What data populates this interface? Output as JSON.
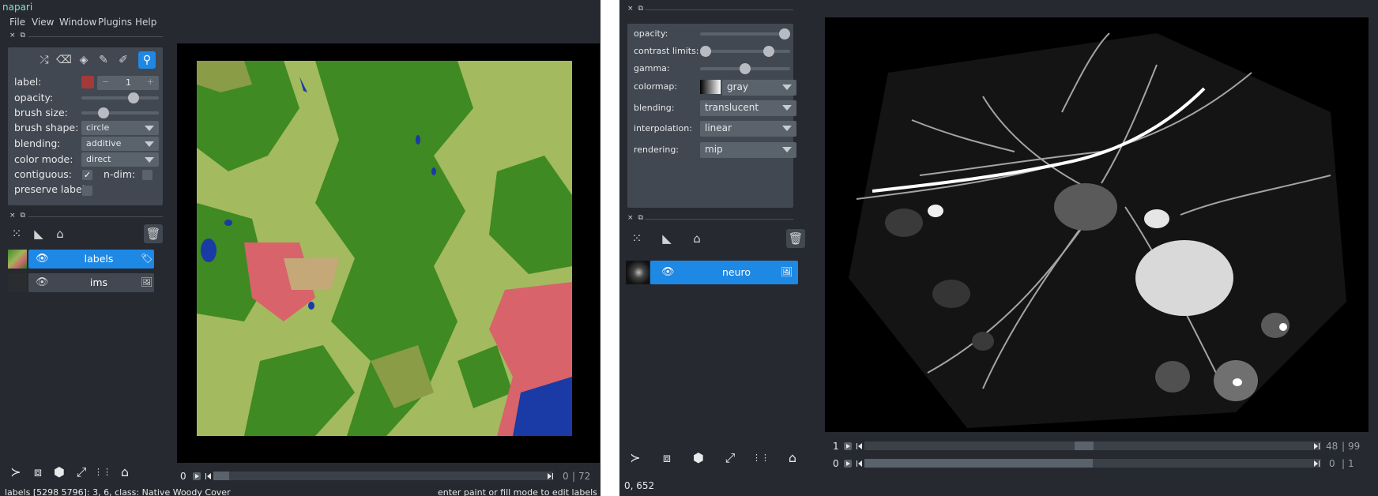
{
  "left": {
    "app_title": "napari",
    "menu": [
      "File",
      "View",
      "Window",
      "Plugins",
      "Help"
    ],
    "dock_controls": [
      "×",
      "⧉"
    ],
    "tools": [
      {
        "name": "shuffle-icon",
        "glyph": "⤮",
        "active": false
      },
      {
        "name": "eraser-icon",
        "glyph": "⌫",
        "active": false
      },
      {
        "name": "fill-icon",
        "glyph": "◈",
        "active": false
      },
      {
        "name": "paint-brush-icon",
        "glyph": "✎",
        "active": false
      },
      {
        "name": "color-picker-icon",
        "glyph": "✐",
        "active": false
      },
      {
        "name": "zoom-icon",
        "glyph": "⚲",
        "active": true
      }
    ],
    "label_label": "label:",
    "label_value": "1",
    "label_minus": "−",
    "label_plus": "+",
    "label_color": "#a33a3a",
    "opacity_label": "opacity:",
    "opacity_value": 0.7,
    "brush_size_label": "brush size:",
    "brush_size_value": 0.25,
    "brush_shape_label": "brush shape:",
    "brush_shape_value": "circle",
    "blending_label": "blending:",
    "blending_value": "additive",
    "color_mode_label": "color mode:",
    "color_mode_value": "direct",
    "contiguous_label": "contiguous:",
    "contiguous_checked": "✓",
    "ndim_label": "n-dim:",
    "preserve_label": "preserve label",
    "layers": [
      {
        "name": "labels",
        "selected": true,
        "type_icon": "label-icon",
        "glyph": "🏷"
      },
      {
        "name": "ims",
        "selected": false,
        "type_icon": "image-icon",
        "glyph": "🖼"
      }
    ],
    "eye_glyph": "👁",
    "dims": {
      "current": "0",
      "current_label": "0",
      "sep": "|",
      "max": "72",
      "fraction": 0.0
    },
    "status_left": "labels [5298 5796]: 3, 6, class: Native Woody Cover",
    "status_right": "enter paint or fill mode to edit labels"
  },
  "right": {
    "dock_controls": [
      "×",
      "⧉"
    ],
    "opacity_label": "opacity:",
    "opacity_value": 1.0,
    "contrast_label": "contrast limits:",
    "contrast_low": 0.0,
    "contrast_high": 0.8,
    "gamma_label": "gamma:",
    "gamma_value": 0.5,
    "colormap_label": "colormap:",
    "colormap_value": "gray",
    "blending_label": "blending:",
    "blending_value": "translucent",
    "interpolation_label": "interpolation:",
    "interpolation_value": "linear",
    "rendering_label": "rendering:",
    "rendering_value": "mip",
    "layers": [
      {
        "name": "neuro",
        "selected": true,
        "type_icon": "image-icon",
        "glyph": "🖼"
      }
    ],
    "eye_glyph": "👁",
    "dims": [
      {
        "axis": "1",
        "current": "48",
        "sep": "|",
        "max": "99",
        "fraction": 0.48
      },
      {
        "axis": "0",
        "current": "0",
        "sep": "|",
        "max": "1",
        "fraction": 0.5
      }
    ],
    "status_left": "0, 652"
  },
  "layer_tools": [
    {
      "name": "new-points-icon",
      "glyph": "⁙"
    },
    {
      "name": "new-shapes-icon",
      "glyph": "◣"
    },
    {
      "name": "new-labels-icon",
      "glyph": "⌂"
    }
  ],
  "delete_glyph": "🗑",
  "bottom_buttons": [
    {
      "name": "console-icon",
      "glyph": "≻"
    },
    {
      "name": "ndisplay-icon",
      "glyph": "⧈"
    },
    {
      "name": "roll-dims-icon",
      "glyph": "⬢"
    },
    {
      "name": "transpose-icon",
      "glyph": "⤢"
    },
    {
      "name": "grid-icon",
      "glyph": "⋮⋮"
    },
    {
      "name": "home-icon",
      "glyph": "⌂"
    }
  ],
  "colors": {
    "accent": "#1e88e5",
    "background": "#262930",
    "panel": "#414851",
    "control": "#5a626c"
  }
}
